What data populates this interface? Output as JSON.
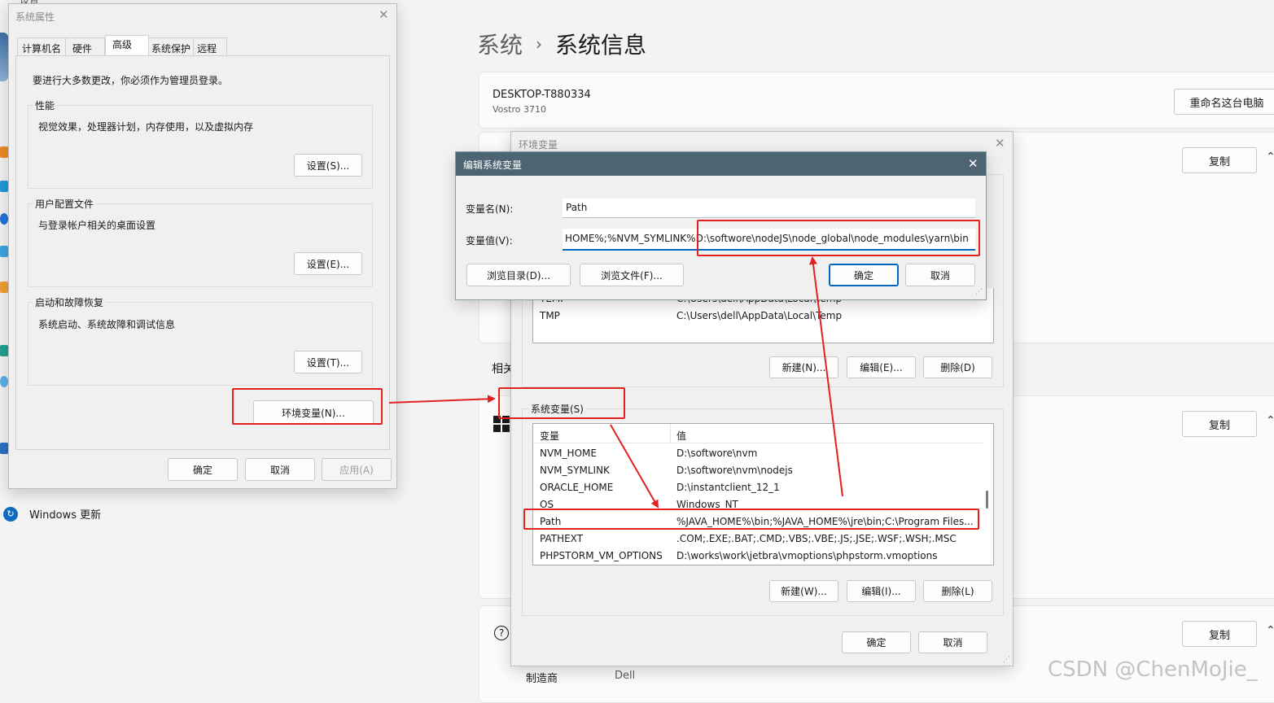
{
  "settings": {
    "breadcrumb_parent": "系统",
    "breadcrumb_sep": "›",
    "breadcrumb_current": "系统信息",
    "device_name": "DESKTOP-T880334",
    "device_model": "Vostro 3710",
    "rename_button": "重命名这台电脑",
    "copy_button": "复制",
    "related_label": "相关",
    "manufacturer_label": "制造商",
    "manufacturer_value": "Dell",
    "windows_update": "Windows 更新",
    "top_left_cut_text": "设置"
  },
  "sys_props": {
    "title": "系统属性",
    "tabs": [
      "计算机名",
      "硬件",
      "高级",
      "系统保护",
      "远程"
    ],
    "active_tab": "高级",
    "admin_note": "要进行大多数更改，你必须作为管理员登录。",
    "performance": {
      "title": "性能",
      "desc": "视觉效果，处理器计划，内存使用，以及虚拟内存",
      "button": "设置(S)..."
    },
    "user_profile": {
      "title": "用户配置文件",
      "desc": "与登录帐户相关的桌面设置",
      "button": "设置(E)..."
    },
    "startup": {
      "title": "启动和故障恢复",
      "desc": "系统启动、系统故障和调试信息",
      "button": "设置(T)..."
    },
    "env_button": "环境变量(N)...",
    "ok": "确定",
    "cancel": "取消",
    "apply": "应用(A)"
  },
  "env_vars": {
    "title": "环境变量",
    "user_rows": [
      {
        "name": "TEMP",
        "value": "C:\\Users\\dell\\AppData\\Local\\Temp"
      },
      {
        "name": "TMP",
        "value": "C:\\Users\\dell\\AppData\\Local\\Temp"
      }
    ],
    "user_new": "新建(N)...",
    "user_edit": "编辑(E)...",
    "user_delete": "删除(D)",
    "system_group_title": "系统变量(S)",
    "col_variable": "变量",
    "col_value": "值",
    "system_rows": [
      {
        "name": "NVM_HOME",
        "value": "D:\\softwore\\nvm"
      },
      {
        "name": "NVM_SYMLINK",
        "value": "D:\\softwore\\nvm\\nodejs"
      },
      {
        "name": "ORACLE_HOME",
        "value": "D:\\instantclient_12_1"
      },
      {
        "name": "OS",
        "value": "Windows_NT"
      },
      {
        "name": "Path",
        "value": "%JAVA_HOME%\\bin;%JAVA_HOME%\\jre\\bin;C:\\Program Files..."
      },
      {
        "name": "PATHEXT",
        "value": ".COM;.EXE;.BAT;.CMD;.VBS;.VBE;.JS;.JSE;.WSF;.WSH;.MSC"
      },
      {
        "name": "PHPSTORM_VM_OPTIONS",
        "value": "D:\\works\\work\\jetbra\\vmoptions\\phpstorm.vmoptions"
      }
    ],
    "sys_new": "新建(W)...",
    "sys_edit": "编辑(I)...",
    "sys_delete": "删除(L)",
    "ok": "确定",
    "cancel": "取消"
  },
  "edit_var": {
    "title": "编辑系统变量",
    "name_label": "变量名(N):",
    "value_label": "变量值(V):",
    "name_value": "Path",
    "value_prefix": "HOME%;%NVM_SYMLINK%",
    "value_highlight": "D:\\softwore\\nodeJS\\node_global\\node_modules\\yarn\\bin",
    "browse_dir": "浏览目录(D)...",
    "browse_file": "浏览文件(F)...",
    "ok": "确定",
    "cancel": "取消"
  },
  "watermark": "CSDN @ChenMoJie_",
  "colors": {
    "annotation_red": "#e22020",
    "accent_blue": "#0067c0",
    "dialog_title_bg": "#4d6473"
  }
}
